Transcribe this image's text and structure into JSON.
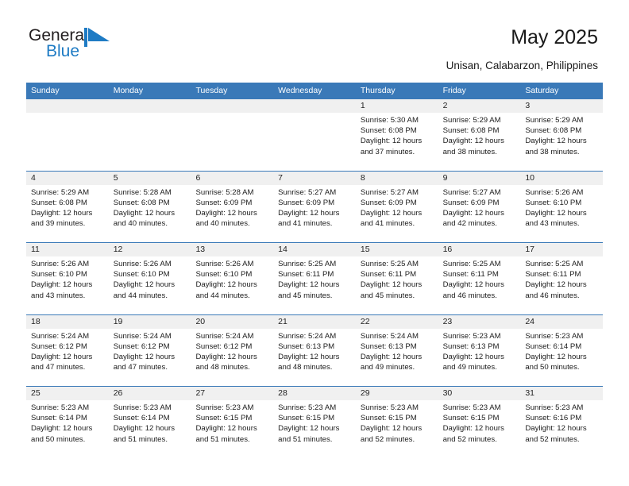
{
  "brand": {
    "name_part1": "General",
    "name_part2": "Blue",
    "flag_color": "#1e7bc4",
    "text_color": "#231f20"
  },
  "header": {
    "title": "May 2025",
    "subtitle": "Unisan, Calabarzon, Philippines"
  },
  "theme": {
    "header_blue": "#3a79b8",
    "daynum_strip": "#f0f0f0",
    "cell_background": "#ffffff"
  },
  "weekdays": [
    "Sunday",
    "Monday",
    "Tuesday",
    "Wednesday",
    "Thursday",
    "Friday",
    "Saturday"
  ],
  "weeks": [
    [
      {
        "day": "",
        "empty": true,
        "lines": []
      },
      {
        "day": "",
        "empty": true,
        "lines": []
      },
      {
        "day": "",
        "empty": true,
        "lines": []
      },
      {
        "day": "",
        "empty": true,
        "lines": []
      },
      {
        "day": "1",
        "empty": false,
        "lines": [
          "Sunrise: 5:30 AM",
          "Sunset: 6:08 PM",
          "Daylight: 12 hours",
          "and 37 minutes."
        ]
      },
      {
        "day": "2",
        "empty": false,
        "lines": [
          "Sunrise: 5:29 AM",
          "Sunset: 6:08 PM",
          "Daylight: 12 hours",
          "and 38 minutes."
        ]
      },
      {
        "day": "3",
        "empty": false,
        "lines": [
          "Sunrise: 5:29 AM",
          "Sunset: 6:08 PM",
          "Daylight: 12 hours",
          "and 38 minutes."
        ]
      }
    ],
    [
      {
        "day": "4",
        "empty": false,
        "lines": [
          "Sunrise: 5:29 AM",
          "Sunset: 6:08 PM",
          "Daylight: 12 hours",
          "and 39 minutes."
        ]
      },
      {
        "day": "5",
        "empty": false,
        "lines": [
          "Sunrise: 5:28 AM",
          "Sunset: 6:08 PM",
          "Daylight: 12 hours",
          "and 40 minutes."
        ]
      },
      {
        "day": "6",
        "empty": false,
        "lines": [
          "Sunrise: 5:28 AM",
          "Sunset: 6:09 PM",
          "Daylight: 12 hours",
          "and 40 minutes."
        ]
      },
      {
        "day": "7",
        "empty": false,
        "lines": [
          "Sunrise: 5:27 AM",
          "Sunset: 6:09 PM",
          "Daylight: 12 hours",
          "and 41 minutes."
        ]
      },
      {
        "day": "8",
        "empty": false,
        "lines": [
          "Sunrise: 5:27 AM",
          "Sunset: 6:09 PM",
          "Daylight: 12 hours",
          "and 41 minutes."
        ]
      },
      {
        "day": "9",
        "empty": false,
        "lines": [
          "Sunrise: 5:27 AM",
          "Sunset: 6:09 PM",
          "Daylight: 12 hours",
          "and 42 minutes."
        ]
      },
      {
        "day": "10",
        "empty": false,
        "lines": [
          "Sunrise: 5:26 AM",
          "Sunset: 6:10 PM",
          "Daylight: 12 hours",
          "and 43 minutes."
        ]
      }
    ],
    [
      {
        "day": "11",
        "empty": false,
        "lines": [
          "Sunrise: 5:26 AM",
          "Sunset: 6:10 PM",
          "Daylight: 12 hours",
          "and 43 minutes."
        ]
      },
      {
        "day": "12",
        "empty": false,
        "lines": [
          "Sunrise: 5:26 AM",
          "Sunset: 6:10 PM",
          "Daylight: 12 hours",
          "and 44 minutes."
        ]
      },
      {
        "day": "13",
        "empty": false,
        "lines": [
          "Sunrise: 5:26 AM",
          "Sunset: 6:10 PM",
          "Daylight: 12 hours",
          "and 44 minutes."
        ]
      },
      {
        "day": "14",
        "empty": false,
        "lines": [
          "Sunrise: 5:25 AM",
          "Sunset: 6:11 PM",
          "Daylight: 12 hours",
          "and 45 minutes."
        ]
      },
      {
        "day": "15",
        "empty": false,
        "lines": [
          "Sunrise: 5:25 AM",
          "Sunset: 6:11 PM",
          "Daylight: 12 hours",
          "and 45 minutes."
        ]
      },
      {
        "day": "16",
        "empty": false,
        "lines": [
          "Sunrise: 5:25 AM",
          "Sunset: 6:11 PM",
          "Daylight: 12 hours",
          "and 46 minutes."
        ]
      },
      {
        "day": "17",
        "empty": false,
        "lines": [
          "Sunrise: 5:25 AM",
          "Sunset: 6:11 PM",
          "Daylight: 12 hours",
          "and 46 minutes."
        ]
      }
    ],
    [
      {
        "day": "18",
        "empty": false,
        "lines": [
          "Sunrise: 5:24 AM",
          "Sunset: 6:12 PM",
          "Daylight: 12 hours",
          "and 47 minutes."
        ]
      },
      {
        "day": "19",
        "empty": false,
        "lines": [
          "Sunrise: 5:24 AM",
          "Sunset: 6:12 PM",
          "Daylight: 12 hours",
          "and 47 minutes."
        ]
      },
      {
        "day": "20",
        "empty": false,
        "lines": [
          "Sunrise: 5:24 AM",
          "Sunset: 6:12 PM",
          "Daylight: 12 hours",
          "and 48 minutes."
        ]
      },
      {
        "day": "21",
        "empty": false,
        "lines": [
          "Sunrise: 5:24 AM",
          "Sunset: 6:13 PM",
          "Daylight: 12 hours",
          "and 48 minutes."
        ]
      },
      {
        "day": "22",
        "empty": false,
        "lines": [
          "Sunrise: 5:24 AM",
          "Sunset: 6:13 PM",
          "Daylight: 12 hours",
          "and 49 minutes."
        ]
      },
      {
        "day": "23",
        "empty": false,
        "lines": [
          "Sunrise: 5:23 AM",
          "Sunset: 6:13 PM",
          "Daylight: 12 hours",
          "and 49 minutes."
        ]
      },
      {
        "day": "24",
        "empty": false,
        "lines": [
          "Sunrise: 5:23 AM",
          "Sunset: 6:14 PM",
          "Daylight: 12 hours",
          "and 50 minutes."
        ]
      }
    ],
    [
      {
        "day": "25",
        "empty": false,
        "lines": [
          "Sunrise: 5:23 AM",
          "Sunset: 6:14 PM",
          "Daylight: 12 hours",
          "and 50 minutes."
        ]
      },
      {
        "day": "26",
        "empty": false,
        "lines": [
          "Sunrise: 5:23 AM",
          "Sunset: 6:14 PM",
          "Daylight: 12 hours",
          "and 51 minutes."
        ]
      },
      {
        "day": "27",
        "empty": false,
        "lines": [
          "Sunrise: 5:23 AM",
          "Sunset: 6:15 PM",
          "Daylight: 12 hours",
          "and 51 minutes."
        ]
      },
      {
        "day": "28",
        "empty": false,
        "lines": [
          "Sunrise: 5:23 AM",
          "Sunset: 6:15 PM",
          "Daylight: 12 hours",
          "and 51 minutes."
        ]
      },
      {
        "day": "29",
        "empty": false,
        "lines": [
          "Sunrise: 5:23 AM",
          "Sunset: 6:15 PM",
          "Daylight: 12 hours",
          "and 52 minutes."
        ]
      },
      {
        "day": "30",
        "empty": false,
        "lines": [
          "Sunrise: 5:23 AM",
          "Sunset: 6:15 PM",
          "Daylight: 12 hours",
          "and 52 minutes."
        ]
      },
      {
        "day": "31",
        "empty": false,
        "lines": [
          "Sunrise: 5:23 AM",
          "Sunset: 6:16 PM",
          "Daylight: 12 hours",
          "and 52 minutes."
        ]
      }
    ]
  ]
}
